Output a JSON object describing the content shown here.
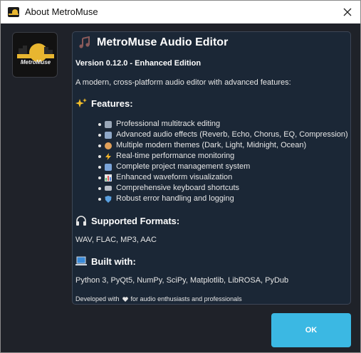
{
  "window": {
    "title": "About MetroMuse",
    "close_icon": "close-icon"
  },
  "logo": {
    "text": "MetroMuse",
    "icon": "metromuse-logo"
  },
  "app": {
    "name": "MetroMuse Audio Editor",
    "version_line": "Version 0.12.0 - Enhanced Edition",
    "description": "A modern, cross-platform audio editor with advanced features:"
  },
  "features": {
    "heading": "Features:",
    "icon": "sparkles-icon",
    "items": [
      {
        "label": "Professional multitrack editing",
        "icon": "film-frames-icon",
        "color": "#9aa7b8"
      },
      {
        "label": "Advanced audio effects (Reverb, Echo, Chorus, EQ, Compression)",
        "icon": "control-knobs-icon",
        "color": "#8fa8c8"
      },
      {
        "label": "Multiple modern themes (Dark, Light, Midnight, Ocean)",
        "icon": "palette-icon",
        "color": "#e0a05a"
      },
      {
        "label": "Real-time performance monitoring",
        "icon": "lightning-icon",
        "color": "#f5b52a"
      },
      {
        "label": "Complete project management system",
        "icon": "floppy-disk-icon",
        "color": "#7aa3d8"
      },
      {
        "label": "Enhanced waveform visualization",
        "icon": "bar-chart-icon",
        "color": "#58b66a"
      },
      {
        "label": "Comprehensive keyboard shortcuts",
        "icon": "keyboard-icon",
        "color": "#b8bec8"
      },
      {
        "label": "Robust error handling and logging",
        "icon": "shield-icon",
        "color": "#5aa0e0"
      }
    ]
  },
  "formats": {
    "heading": "Supported Formats:",
    "icon": "headphones-icon",
    "text": "WAV, FLAC, MP3, AAC"
  },
  "built": {
    "heading": "Built with:",
    "icon": "laptop-icon",
    "text": "Python 3, PyQt5, NumPy, SciPy, Matplotlib, LibROSA, PyDub"
  },
  "footer": {
    "before": "Developed with",
    "after": "for audio enthusiasts and professionals",
    "icon": "heart-icon"
  },
  "buttons": {
    "ok_label": "OK"
  },
  "colors": {
    "accent": "#3bb8e3",
    "panel": "#1b2736",
    "background": "#1f2229"
  }
}
